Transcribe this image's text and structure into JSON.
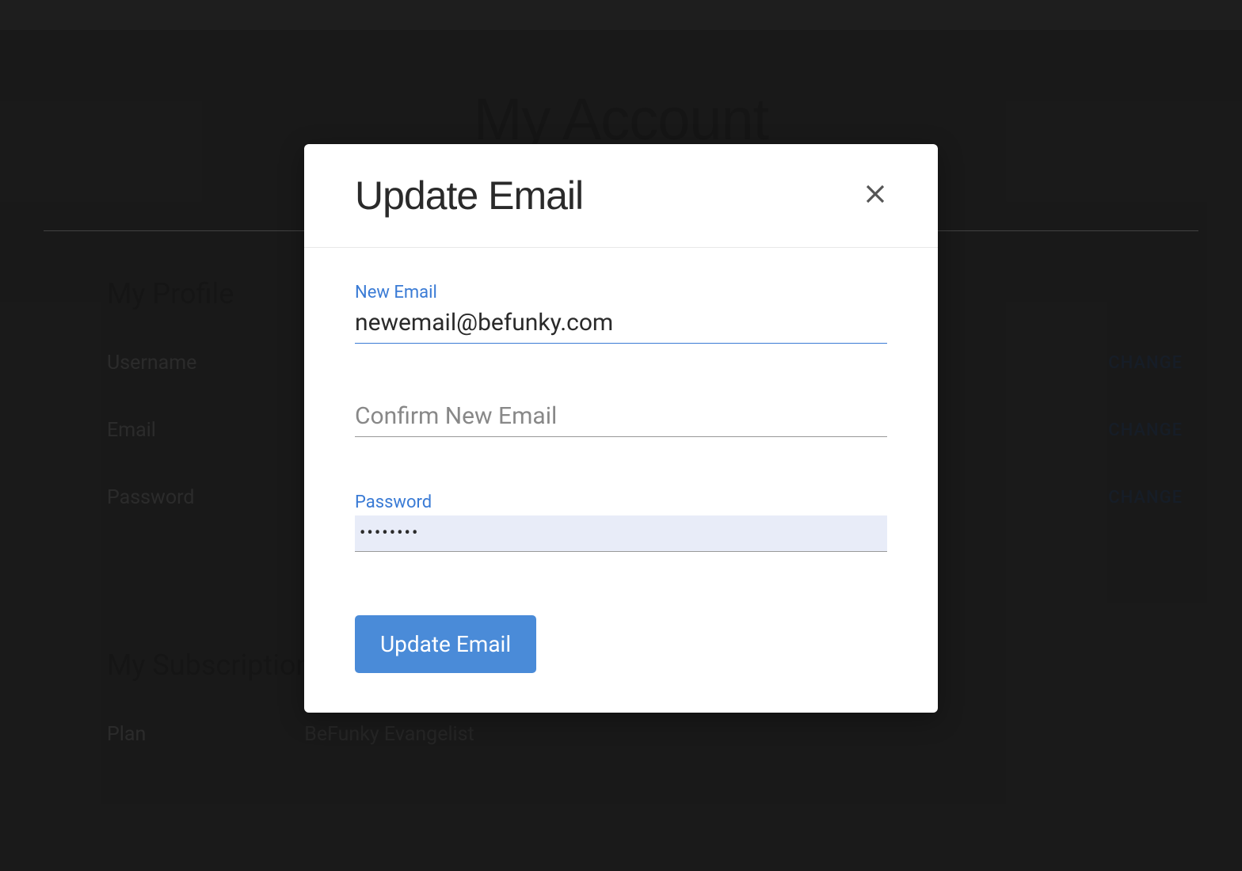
{
  "page": {
    "title": "My Account"
  },
  "profile": {
    "section_title": "My Profile",
    "rows": {
      "username": {
        "label": "Username",
        "change_label": "CHANGE"
      },
      "email": {
        "label": "Email",
        "change_label": "CHANGE"
      },
      "password": {
        "label": "Password",
        "change_label": "CHANGE"
      }
    }
  },
  "subscription": {
    "section_title": "My Subscription",
    "plan": {
      "label": "Plan",
      "value": "BeFunky Evangelist"
    }
  },
  "modal": {
    "title": "Update Email",
    "fields": {
      "new_email": {
        "label": "New Email",
        "value": "newemail@befunky.com"
      },
      "confirm_email": {
        "placeholder": "Confirm New Email"
      },
      "password": {
        "label": "Password",
        "value": "••••••••"
      }
    },
    "submit_label": "Update Email"
  }
}
